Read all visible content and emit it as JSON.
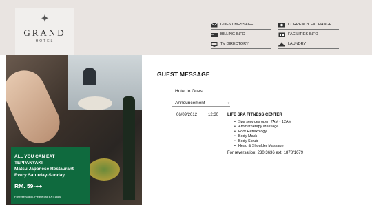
{
  "brand": {
    "star": "✦",
    "name": "GRAND",
    "sub": "HOTEL"
  },
  "menu": {
    "left": [
      {
        "label": "GUEST MESSAGE",
        "icon": "envelope-icon"
      },
      {
        "label": "BILLING INFO",
        "icon": "billing-icon"
      },
      {
        "label": "TV DIRECTORY",
        "icon": "tv-icon"
      }
    ],
    "right": [
      {
        "label": "CURRENCY EXCHANGE",
        "icon": "currency-icon"
      },
      {
        "label": "FACILITIES INFO",
        "icon": "facilities-icon"
      },
      {
        "label": "LAUNDRY",
        "icon": "laundry-icon"
      }
    ]
  },
  "promo": {
    "line1": "ALL YOU CAN EAT",
    "line2": "TEPPANYAKI",
    "line3": "Matsu Japanese Restaurant",
    "line4": "Every Saturday-Sunday",
    "price": "RM. 59-++",
    "note": "For reservation, Please call EXT 1886"
  },
  "content": {
    "title": "GUEST MESSAGE",
    "label": "Hotel to Guest",
    "select_value": "Announcement",
    "message": {
      "date": "06/09/2012",
      "time": "12:30",
      "subject": "LIFE SPA FITNESS CENTER",
      "items": [
        "Spa services open 7AM - 12AM",
        "Aromatherapy Massage",
        "Foot Reflexology",
        "Body Mask",
        "Body Scrub",
        "Head & Shoulder Massage"
      ],
      "footer": "For reversation: 230 3636 ext. 1878/1679"
    }
  }
}
